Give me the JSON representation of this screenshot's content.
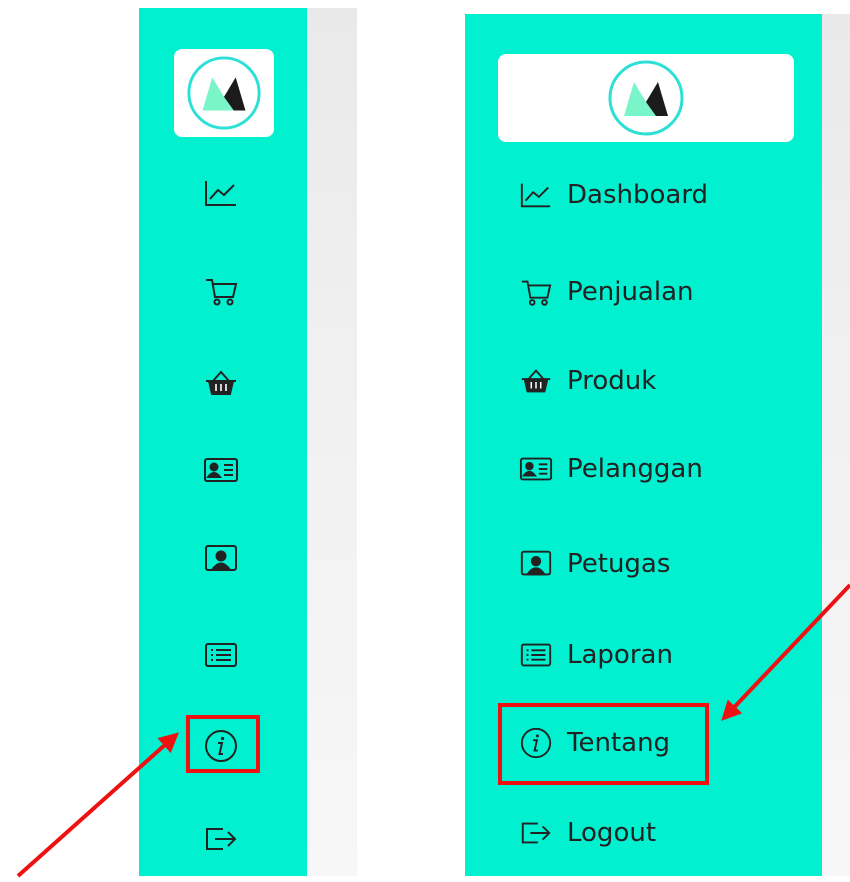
{
  "colors": {
    "sidebar": "#00f0d0",
    "highlight": "#e11111",
    "arrow": "#e11111",
    "icon": "#222222"
  },
  "logo": {
    "icon": "m-logo-icon"
  },
  "nav": {
    "items": [
      {
        "id": "dashboard",
        "label": "Dashboard",
        "icon": "chart-line-icon"
      },
      {
        "id": "penjualan",
        "label": "Penjualan",
        "icon": "cart-icon"
      },
      {
        "id": "produk",
        "label": "Produk",
        "icon": "basket-icon"
      },
      {
        "id": "pelanggan",
        "label": "Pelanggan",
        "icon": "id-card-icon"
      },
      {
        "id": "petugas",
        "label": "Petugas",
        "icon": "user-screen-icon"
      },
      {
        "id": "laporan",
        "label": "Laporan",
        "icon": "list-icon"
      },
      {
        "id": "tentang",
        "label": "Tentang",
        "icon": "info-icon"
      },
      {
        "id": "logout",
        "label": "Logout",
        "icon": "logout-icon"
      }
    ]
  },
  "highlighted_item": "tentang"
}
